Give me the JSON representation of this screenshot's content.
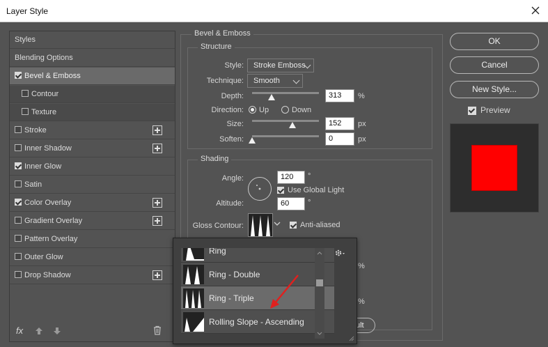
{
  "window": {
    "title": "Layer Style"
  },
  "left_panel": {
    "items": [
      {
        "label": "Styles",
        "checkbox": false,
        "checked": false,
        "sub": false,
        "plus": false,
        "selected": false
      },
      {
        "label": "Blending Options",
        "checkbox": false,
        "checked": false,
        "sub": false,
        "plus": false,
        "selected": false
      },
      {
        "label": "Bevel & Emboss",
        "checkbox": true,
        "checked": true,
        "sub": false,
        "plus": false,
        "selected": true
      },
      {
        "label": "Contour",
        "checkbox": true,
        "checked": false,
        "sub": true,
        "plus": false,
        "selected": false
      },
      {
        "label": "Texture",
        "checkbox": true,
        "checked": false,
        "sub": true,
        "plus": false,
        "selected": false
      },
      {
        "label": "Stroke",
        "checkbox": true,
        "checked": false,
        "sub": false,
        "plus": true,
        "selected": false
      },
      {
        "label": "Inner Shadow",
        "checkbox": true,
        "checked": false,
        "sub": false,
        "plus": true,
        "selected": false
      },
      {
        "label": "Inner Glow",
        "checkbox": true,
        "checked": true,
        "sub": false,
        "plus": false,
        "selected": false
      },
      {
        "label": "Satin",
        "checkbox": true,
        "checked": false,
        "sub": false,
        "plus": false,
        "selected": false
      },
      {
        "label": "Color Overlay",
        "checkbox": true,
        "checked": true,
        "sub": false,
        "plus": true,
        "selected": false
      },
      {
        "label": "Gradient Overlay",
        "checkbox": true,
        "checked": false,
        "sub": false,
        "plus": true,
        "selected": false
      },
      {
        "label": "Pattern Overlay",
        "checkbox": true,
        "checked": false,
        "sub": false,
        "plus": false,
        "selected": false
      },
      {
        "label": "Outer Glow",
        "checkbox": true,
        "checked": false,
        "sub": false,
        "plus": false,
        "selected": false
      },
      {
        "label": "Drop Shadow",
        "checkbox": true,
        "checked": false,
        "sub": false,
        "plus": true,
        "selected": false
      }
    ],
    "footer": {
      "fx_label": "fx"
    }
  },
  "bevel": {
    "title": "Bevel & Emboss",
    "structure": {
      "title": "Structure",
      "style_label": "Style:",
      "style_value": "Stroke Emboss",
      "technique_label": "Technique:",
      "technique_value": "Smooth",
      "depth_label": "Depth:",
      "depth_value": "313",
      "depth_unit": "%",
      "depth_level": 0.29,
      "direction_label": "Direction:",
      "dir_up": "Up",
      "dir_down": "Down",
      "direction_selected": "Up",
      "size_label": "Size:",
      "size_value": "152",
      "size_unit": "px",
      "size_level": 0.6,
      "soften_label": "Soften:",
      "soften_value": "0",
      "soften_unit": "px",
      "soften_level": 0
    },
    "shading": {
      "title": "Shading",
      "angle_label": "Angle:",
      "angle_value": "120",
      "angle_unit": "°",
      "global_light_label": "Use Global Light",
      "global_light_checked": true,
      "altitude_label": "Altitude:",
      "altitude_value": "60",
      "altitude_unit": "°",
      "gloss_label": "Gloss Contour:",
      "antialiased_label": "Anti-aliased",
      "antialiased_checked": true,
      "hidden_unit_1": "%",
      "hidden_unit_2": "%",
      "partial_button": "ult"
    }
  },
  "buttons": {
    "ok": "OK",
    "cancel": "Cancel",
    "new_style": "New Style...",
    "preview_label": "Preview",
    "preview_checked": true
  },
  "preview": {
    "swatch_color": "#ff0000"
  },
  "contour_popup": {
    "items": [
      {
        "label": "Ring",
        "selected": false
      },
      {
        "label": "Ring - Double",
        "selected": false
      },
      {
        "label": "Ring - Triple",
        "selected": true
      },
      {
        "label": "Rolling Slope - Ascending",
        "selected": false
      }
    ]
  },
  "annotation": {
    "color": "#e0201e"
  }
}
